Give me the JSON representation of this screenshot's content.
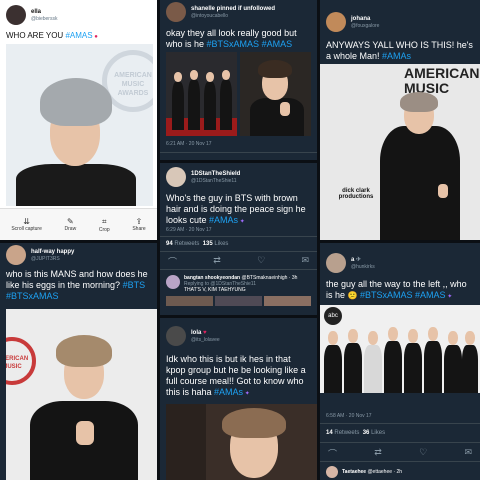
{
  "tiles": {
    "t1": {
      "name": "ella",
      "handle": "@bieberssk",
      "text": "WHO ARE YOU",
      "tag": "#AMAS",
      "toolbar": [
        "Scroll capture",
        "Draw",
        "Crop",
        "Share"
      ],
      "backdrop_logo": "AMERICAN MUSIC AWARDS"
    },
    "t2": {
      "pinned_by": "shanelle pinned if unfollowed",
      "handle": "@intoyoucabello",
      "text": "okay they all look really good but who is he",
      "tags": [
        "#BTSxAMAS",
        "#AMAS"
      ],
      "time": "6:21 AM · 20 Nov 17"
    },
    "t3": {
      "name": "johana",
      "handle": "@fouxgalore",
      "text": "ANYWAYS YALL WHO IS THIS! he's a whole Man!",
      "tag": "#AMAs",
      "backdrop_logo": "AMERICAN MUSIC",
      "sponsor_text": "dick clark productions"
    },
    "t4": {
      "name": "1DStanTheShield",
      "handle": "@1DStanTheShie11",
      "text": "Who's the guy in BTS with brown hair and is doing the peace sign he looks cute",
      "tag": "#AMAs",
      "time": "6:29 AM · 20 Nov 17",
      "retweets": "94",
      "retweets_label": "Retweets",
      "likes": "135",
      "likes_label": "Likes",
      "reply1_name": "bangtan shookyeondan",
      "reply1_handle": "@BTSmaknaeinhigh · 3h",
      "reply1_sub": "Replying to @1DStanTheShie11",
      "reply1_text": "THAT'S V, KIM TAEHYUNG"
    },
    "t5": {
      "name": "half-way happy",
      "handle": "@JUPIT3RS",
      "text": "who is this MANS and how does he like his eggs in the morning?",
      "tags": [
        "#BTS",
        "#BTSxAMAS"
      ],
      "backdrop_logo": "AMERICAN MUSIC"
    },
    "t6": {
      "name": "lola",
      "handle": "@its_lolavee",
      "text": "Idk who this is but ik hes in that kpop group but he be looking like a full course meal!! Got to know who this is haha",
      "tag": "#AMAs"
    },
    "t7": {
      "name": "a",
      "handle": "@hunkirks",
      "text": "the guy all the way to the left ,, who is he",
      "tags": [
        "#BTSxAMAS",
        "#AMAS"
      ],
      "time": "6:58 AM · 20 Nov 17",
      "retweets": "14",
      "retweets_label": "Retweets",
      "likes": "36",
      "likes_label": "Likes",
      "reply_name": "Taetaehee",
      "reply_handle": "@ettaehee · 2h",
      "backdrop_logo": "abc"
    }
  },
  "colors": {
    "tag": "#1da1f2",
    "dark_bg": "#1b2836",
    "muted": "#8899a6"
  }
}
